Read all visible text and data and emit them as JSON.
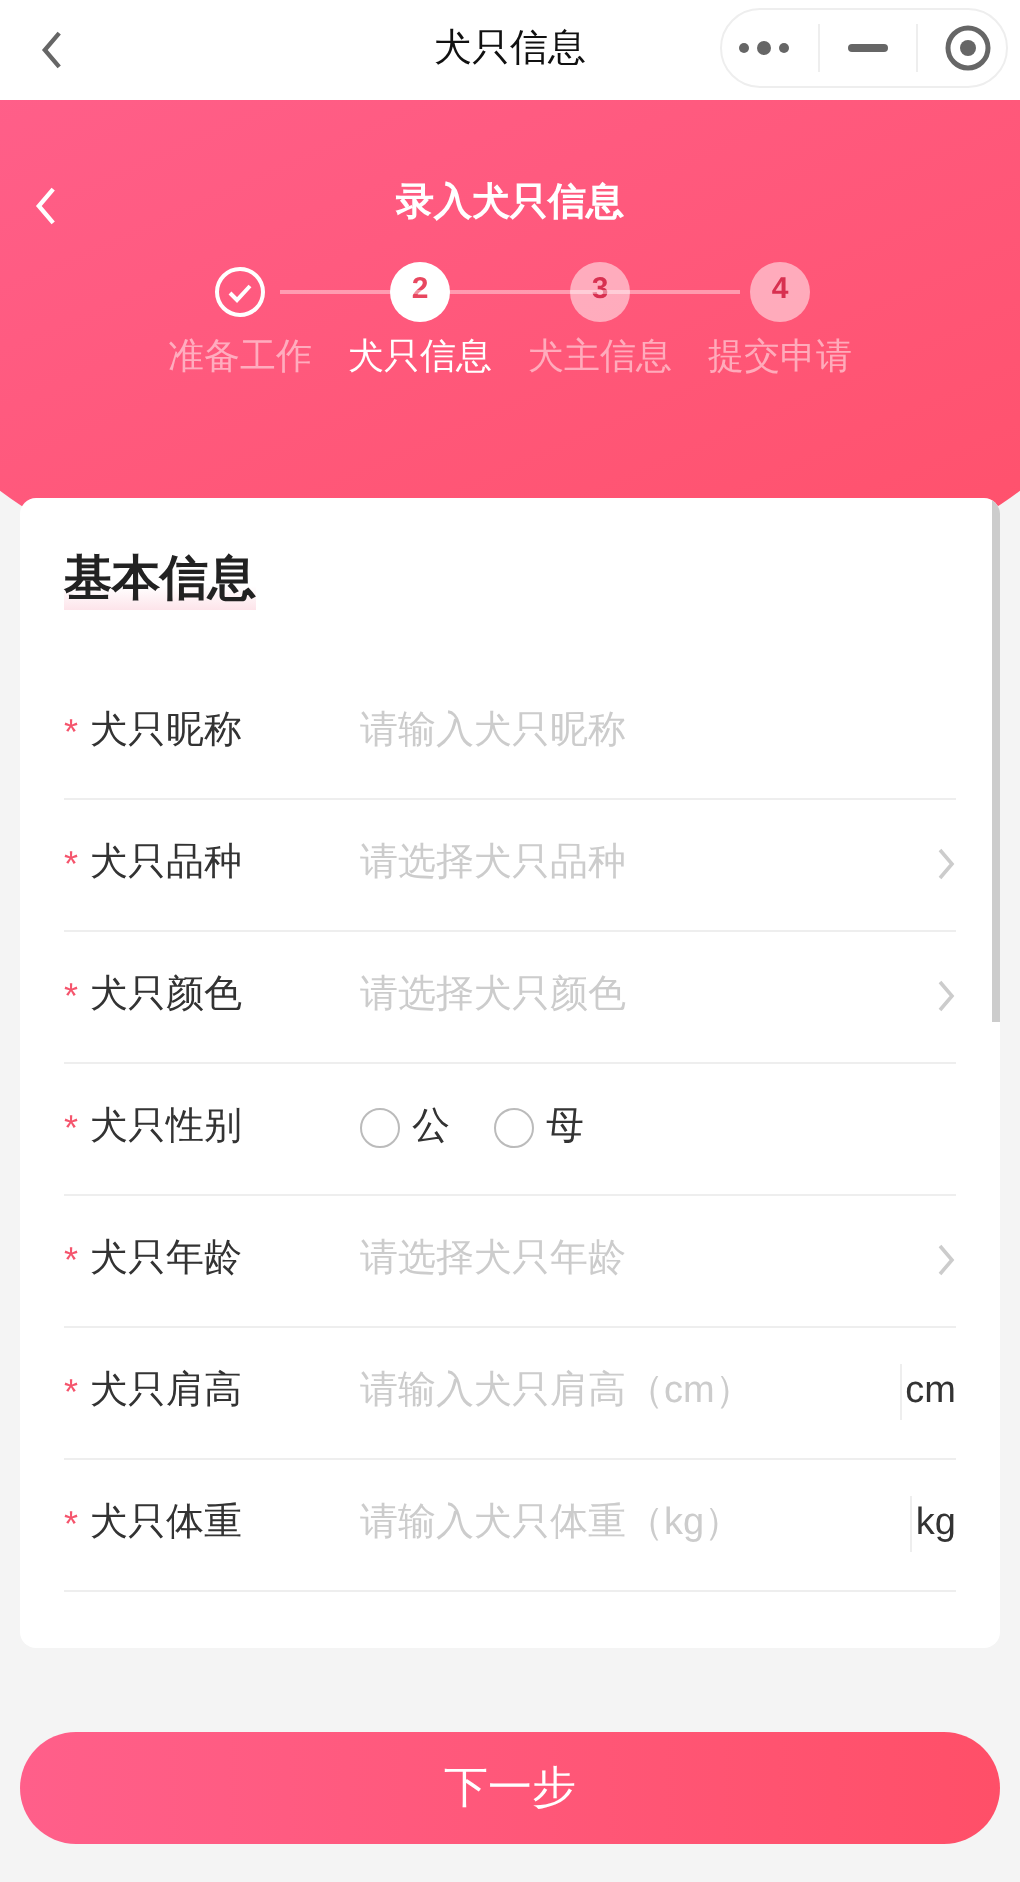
{
  "nav_bar": {
    "title": "犬只信息"
  },
  "header": {
    "title": "录入犬只信息"
  },
  "steps": [
    {
      "label": "准备工作",
      "completed": true,
      "selected": false
    },
    {
      "number": "2",
      "label": "犬只信息",
      "completed": false,
      "selected": true
    },
    {
      "number": "3",
      "label": "犬主信息",
      "completed": false,
      "selected": false
    },
    {
      "number": "4",
      "label": "提交申请",
      "completed": false,
      "selected": false
    }
  ],
  "section": {
    "title": "基本信息"
  },
  "fields": [
    {
      "kind": "input",
      "required_mark": "*",
      "label": "犬只昵称",
      "placeholder": "请输入犬只昵称"
    },
    {
      "kind": "select",
      "required_mark": "*",
      "label": "犬只品种",
      "placeholder": "请选择犬只品种"
    },
    {
      "kind": "select",
      "required_mark": "*",
      "label": "犬只颜色",
      "placeholder": "请选择犬只颜色"
    },
    {
      "kind": "radio",
      "required_mark": "*",
      "label": "犬只性别",
      "options": [
        {
          "label": "公",
          "selected": false
        },
        {
          "label": "母",
          "selected": false
        }
      ]
    },
    {
      "kind": "select",
      "required_mark": "*",
      "label": "犬只年龄",
      "placeholder": "请选择犬只年龄"
    },
    {
      "kind": "unit",
      "required_mark": "*",
      "label": "犬只肩高",
      "placeholder": "请输入犬只肩高（cm）",
      "unit": "cm"
    },
    {
      "kind": "unit",
      "required_mark": "*",
      "label": "犬只体重",
      "placeholder": "请输入犬只体重（kg）",
      "unit": "kg"
    }
  ],
  "next_button": {
    "label": "下一步"
  }
}
